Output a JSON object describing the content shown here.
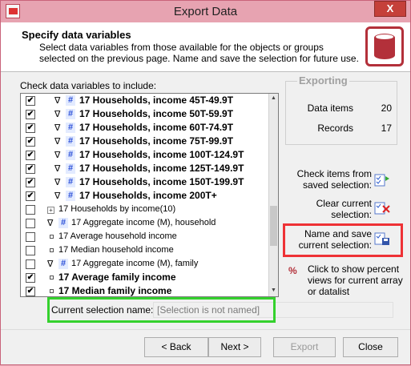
{
  "window": {
    "title": "Export Data",
    "close_glyph": "X"
  },
  "header": {
    "title": "Specify data variables",
    "description": "Select data variables from those available for the objects or groups selected on the previous page. Name and save the selection for future use."
  },
  "list": {
    "label": "Check data variables to include:",
    "items": [
      {
        "label": "17 Households, income 45T-49.9T",
        "checked": "✔"
      },
      {
        "label": "17 Households, income 50T-59.9T",
        "checked": "✔"
      },
      {
        "label": "17 Households, income 60T-74.9T",
        "checked": "✔"
      },
      {
        "label": "17 Households, income 75T-99.9T",
        "checked": "✔"
      },
      {
        "label": "17 Households, income 100T-124.9T",
        "checked": "✔"
      },
      {
        "label": "17 Households, income 125T-149.9T",
        "checked": "✔"
      },
      {
        "label": "17 Households, income 150T-199.9T",
        "checked": "✔"
      },
      {
        "label": "17 Households, income 200T+",
        "checked": "✔"
      },
      {
        "label": "17 Households by income(10)",
        "checked": ""
      },
      {
        "label": "17 Aggregate income (M), household",
        "checked": ""
      },
      {
        "label": "17 Average household income",
        "checked": ""
      },
      {
        "label": "17 Median household income",
        "checked": ""
      },
      {
        "label": "17 Aggregate income (M), family",
        "checked": ""
      },
      {
        "label": "17 Average family income",
        "checked": "✔"
      },
      {
        "label": "17 Median family income",
        "checked": "✔"
      }
    ]
  },
  "exporting": {
    "legend": "Exporting",
    "data_items_label": "Data items",
    "data_items_value": "20",
    "records_label": "Records",
    "records_value": "17"
  },
  "actions": {
    "check_saved": "Check items from saved selection:",
    "clear_current": "Clear current selection:",
    "name_save": "Name and save current selection:",
    "percent": "Click to show percent views for current array or datalist",
    "percent_icon": "%"
  },
  "name_field": {
    "label": "Current selection name:",
    "placeholder": "[Selection is not named]"
  },
  "buttons": {
    "back": "< Back",
    "next": "Next >",
    "export": "Export",
    "close": "Close"
  },
  "colors": {
    "highlight_red": "#ee3135",
    "highlight_green": "#34d12d",
    "brand_red": "#b3303a"
  }
}
